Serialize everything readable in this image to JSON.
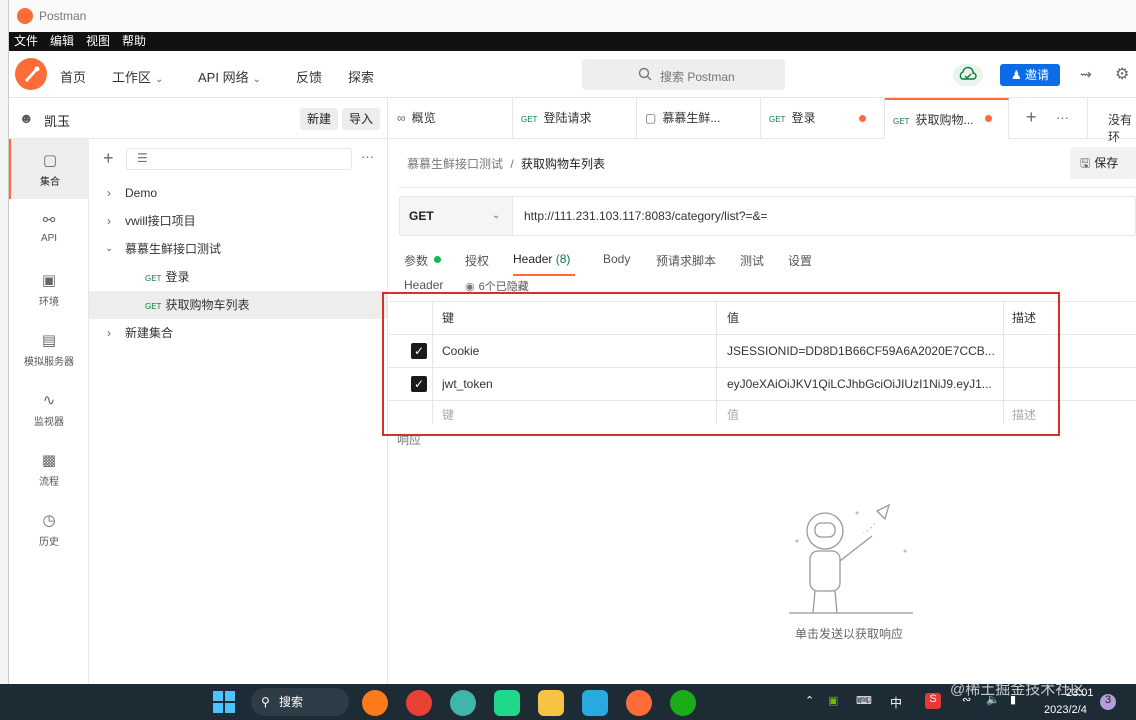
{
  "window": {
    "title": "Postman"
  },
  "menubar": [
    "文件",
    "编辑",
    "视图",
    "帮助"
  ],
  "header": {
    "nav": [
      {
        "label": "首页"
      },
      {
        "label": "工作区",
        "dropdown": true
      },
      {
        "label": "API 网络",
        "dropdown": true
      },
      {
        "label": "反馈"
      },
      {
        "label": "探索"
      }
    ],
    "search_placeholder": "搜索 Postman",
    "invite_label": "邀请"
  },
  "sidebar": {
    "workspace_name": "凯玉",
    "new_label": "新建",
    "import_label": "导入",
    "rail": [
      {
        "label": "集合",
        "icon": "collections-icon",
        "active": true
      },
      {
        "label": "API",
        "icon": "api-icon"
      },
      {
        "label": "环境",
        "icon": "environment-icon"
      },
      {
        "label": "模拟服务器",
        "icon": "mock-server-icon"
      },
      {
        "label": "监视器",
        "icon": "monitor-icon"
      },
      {
        "label": "流程",
        "icon": "flows-icon"
      },
      {
        "label": "历史",
        "icon": "history-icon"
      }
    ],
    "tree": [
      {
        "label": "Demo",
        "level": 0,
        "expanded": false
      },
      {
        "label": "vwill接口项目",
        "level": 0,
        "expanded": false
      },
      {
        "label": "慕慕生鲜接口测试",
        "level": 0,
        "expanded": true
      },
      {
        "label": "登录",
        "level": 1,
        "method": "GET"
      },
      {
        "label": "获取购物车列表",
        "level": 1,
        "method": "GET",
        "selected": true
      },
      {
        "label": "新建集合",
        "level": 0,
        "expanded": false
      }
    ]
  },
  "tabs": [
    {
      "label": "概览",
      "icon": "overview-icon"
    },
    {
      "label": "登陆请求",
      "method": "GET"
    },
    {
      "label": "慕慕生鲜...",
      "icon": "collection-icon"
    },
    {
      "label": "登录",
      "method": "GET",
      "unsaved": true
    },
    {
      "label": "获取购物...",
      "method": "GET",
      "unsaved": true,
      "active": true
    }
  ],
  "no_env_label": "没有环",
  "request": {
    "breadcrumb_parent": "慕慕生鲜接口测试",
    "breadcrumb_sep": "/",
    "breadcrumb_current": "获取购物车列表",
    "save_label": "保存",
    "method": "GET",
    "url": "http://111.231.103.117:8083/category/list?=&=",
    "tabs": [
      {
        "label": "参数",
        "dot": true
      },
      {
        "label": "授权"
      },
      {
        "label": "Header",
        "count": "(8)",
        "active": true
      },
      {
        "label": "Body"
      },
      {
        "label": "预请求脚本"
      },
      {
        "label": "测试"
      },
      {
        "label": "设置"
      }
    ],
    "header_section_label": "Header",
    "hidden_label": "6个已隐藏",
    "table": {
      "col_key": "键",
      "col_value": "值",
      "col_desc": "描述",
      "rows": [
        {
          "checked": true,
          "key": "Cookie",
          "value": "JSESSIONID=DD8D1B66CF59A6A2020E7CCB..."
        },
        {
          "checked": true,
          "key": "jwt_token",
          "value": "eyJ0eXAiOiJKV1QiLCJhbGciOiJIUzI1NiJ9.eyJ1..."
        }
      ],
      "placeholder_key": "键",
      "placeholder_value": "值",
      "placeholder_desc": "描述"
    },
    "response_label": "响应",
    "empty_response_text": "单击发送以获取响应"
  },
  "taskbar": {
    "search_label": "搜索",
    "ime_label": "中",
    "time": "23:01",
    "date": "2023/2/4",
    "notification_count": "3",
    "watermark": "@稀土掘金技术社区"
  }
}
